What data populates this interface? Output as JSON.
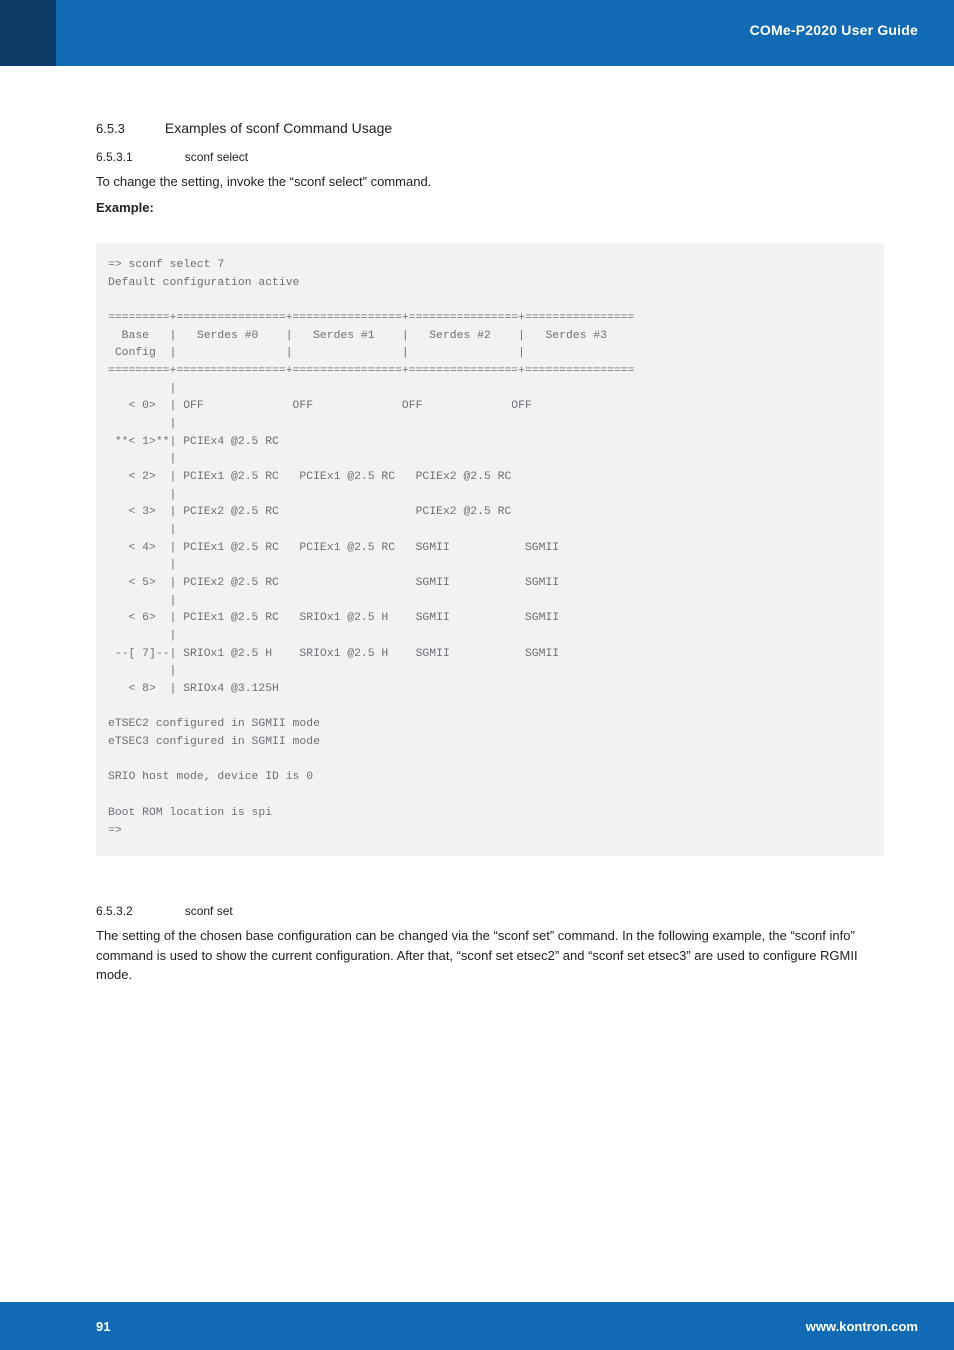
{
  "header": {
    "doc_title": "COMe-P2020 User Guide"
  },
  "section_653": {
    "num": "6.5.3",
    "title": "Examples of sconf Command Usage"
  },
  "section_6531": {
    "num": "6.5.3.1",
    "title": "sconf select",
    "para1": "To change the setting, invoke the “sconf select” command.",
    "para2_label": "Example:"
  },
  "codeblock1": "=> sconf select 7\nDefault configuration active\n\n=========+================+================+================+================\n  Base   |   Serdes #0    |   Serdes #1    |   Serdes #2    |   Serdes #3\n Config  |                |                |                |\n=========+================+================+================+================\n         |\n   < 0>  | OFF             OFF             OFF             OFF\n         |\n **< 1>**| PCIEx4 @2.5 RC\n         |\n   < 2>  | PCIEx1 @2.5 RC   PCIEx1 @2.5 RC   PCIEx2 @2.5 RC\n         |\n   < 3>  | PCIEx2 @2.5 RC                    PCIEx2 @2.5 RC\n         |\n   < 4>  | PCIEx1 @2.5 RC   PCIEx1 @2.5 RC   SGMII           SGMII\n         |\n   < 5>  | PCIEx2 @2.5 RC                    SGMII           SGMII\n         |\n   < 6>  | PCIEx1 @2.5 RC   SRIOx1 @2.5 H    SGMII           SGMII\n         |\n --[ 7]--| SRIOx1 @2.5 H    SRIOx1 @2.5 H    SGMII           SGMII\n         |\n   < 8>  | SRIOx4 @3.125H\n\neTSEC2 configured in SGMII mode\neTSEC3 configured in SGMII mode\n\nSRIO host mode, device ID is 0\n\nBoot ROM location is spi\n=>",
  "section_6532": {
    "num": "6.5.3.2",
    "title": "sconf set",
    "para": "The setting of the chosen base configuration can be changed via the “sconf set” command. In the following example, the “sconf info” command is used to show the current configuration. After that, “sconf set etsec2” and “sconf set etsec3” are used to configure RGMII mode."
  },
  "footer": {
    "page_number": "91",
    "url": "www.kontron.com"
  }
}
